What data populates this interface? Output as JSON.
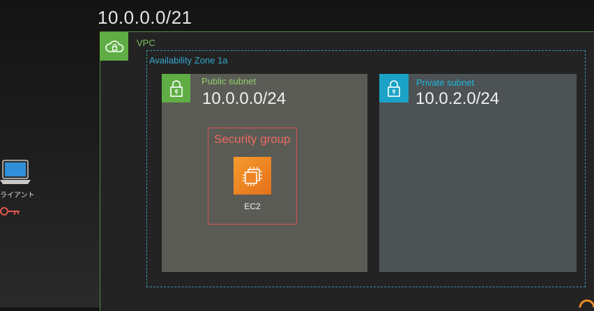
{
  "header": {
    "cidr": "10.0.0.0/21"
  },
  "vpc": {
    "label": "VPC",
    "icon": "cloud-lock-icon",
    "color": "#5fae45"
  },
  "availability_zone": {
    "label": "Availability Zone 1a",
    "color": "#36a7d0"
  },
  "public_subnet": {
    "label": "Public subnet",
    "cidr": "10.0.0.0/24",
    "icon": "lock-icon",
    "color": "#5fae45"
  },
  "private_subnet": {
    "label": "Private subnet",
    "cidr": "10.0.2.0/24",
    "icon": "lock-icon",
    "color": "#1aa3c7"
  },
  "security_group": {
    "label": "Security group",
    "color": "#ec6b5e"
  },
  "ec2": {
    "label": "EC2",
    "icon": "ec2-chip-icon",
    "color": "#f08a24"
  },
  "client": {
    "label": "ライアント",
    "icon": "laptop-icon",
    "key_icon": "key-icon"
  }
}
